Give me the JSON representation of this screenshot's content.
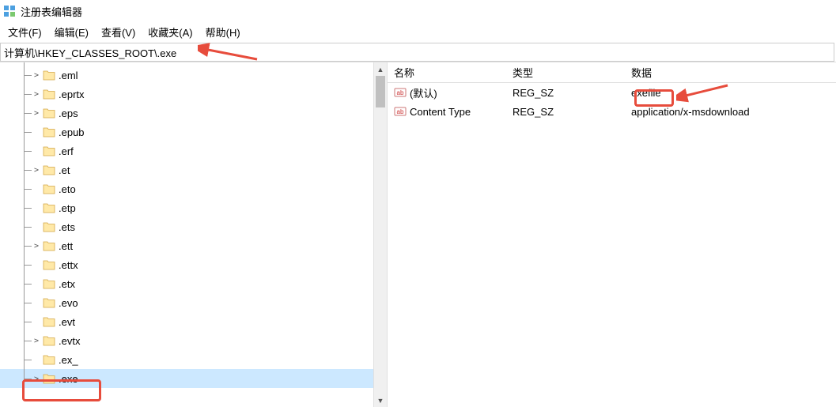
{
  "titlebar": {
    "title": "注册表编辑器"
  },
  "menubar": {
    "items": [
      "文件(F)",
      "编辑(E)",
      "查看(V)",
      "收藏夹(A)",
      "帮助(H)"
    ]
  },
  "address": {
    "path": "计算机\\HKEY_CLASSES_ROOT\\.exe"
  },
  "tree": {
    "items": [
      {
        "label": ".eml",
        "expandable": true
      },
      {
        "label": ".eprtx",
        "expandable": true
      },
      {
        "label": ".eps",
        "expandable": true
      },
      {
        "label": ".epub",
        "expandable": false
      },
      {
        "label": ".erf",
        "expandable": false
      },
      {
        "label": ".et",
        "expandable": true
      },
      {
        "label": ".eto",
        "expandable": false
      },
      {
        "label": ".etp",
        "expandable": false
      },
      {
        "label": ".ets",
        "expandable": false
      },
      {
        "label": ".ett",
        "expandable": true
      },
      {
        "label": ".ettx",
        "expandable": false
      },
      {
        "label": ".etx",
        "expandable": false
      },
      {
        "label": ".evo",
        "expandable": false
      },
      {
        "label": ".evt",
        "expandable": false
      },
      {
        "label": ".evtx",
        "expandable": true
      },
      {
        "label": ".ex_",
        "expandable": false
      },
      {
        "label": ".exe",
        "expandable": true,
        "selected": true
      }
    ]
  },
  "list": {
    "headers": {
      "name": "名称",
      "type": "类型",
      "data": "数据"
    },
    "rows": [
      {
        "name": "(默认)",
        "type": "REG_SZ",
        "data": "exefile"
      },
      {
        "name": "Content Type",
        "type": "REG_SZ",
        "data": "application/x-msdownload"
      }
    ]
  }
}
